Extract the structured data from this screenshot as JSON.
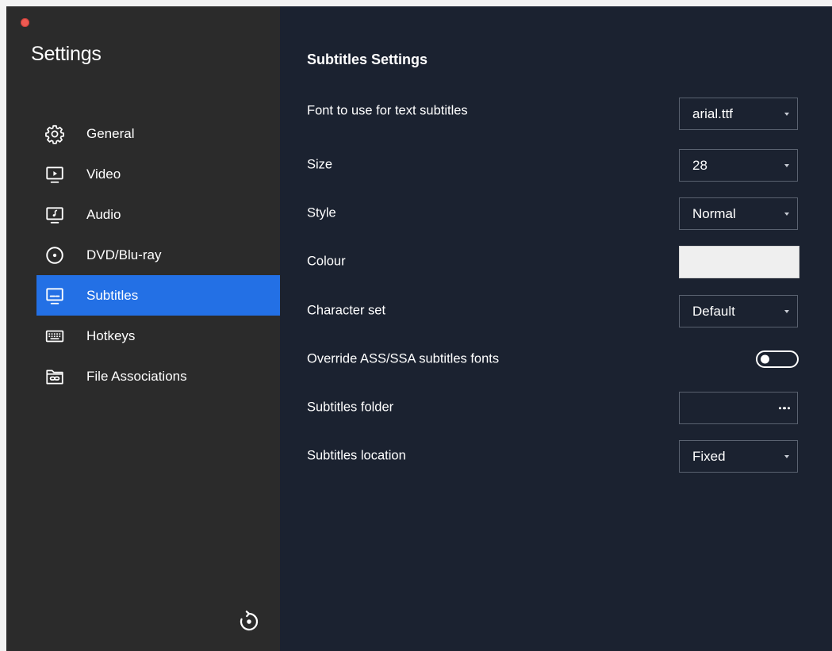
{
  "sidebar": {
    "title": "Settings",
    "items": [
      {
        "label": "General",
        "icon": "gear-icon",
        "active": false
      },
      {
        "label": "Video",
        "icon": "video-monitor-icon",
        "active": false
      },
      {
        "label": "Audio",
        "icon": "audio-monitor-icon",
        "active": false
      },
      {
        "label": "DVD/Blu-ray",
        "icon": "disc-icon",
        "active": false
      },
      {
        "label": "Subtitles",
        "icon": "subtitles-icon",
        "active": true
      },
      {
        "label": "Hotkeys",
        "icon": "keyboard-icon",
        "active": false
      },
      {
        "label": "File Associations",
        "icon": "folder-link-icon",
        "active": false
      }
    ],
    "reset_icon": "reset-icon"
  },
  "main": {
    "title": "Subtitles Settings",
    "font": {
      "label": "Font to use for text subtitles",
      "value": "arial.ttf"
    },
    "size": {
      "label": "Size",
      "value": "28"
    },
    "style": {
      "label": "Style",
      "value": "Normal"
    },
    "colour": {
      "label": "Colour",
      "value": "#efefef"
    },
    "charset": {
      "label": "Character set",
      "value": "Default"
    },
    "override": {
      "label": "Override ASS/SSA subtitles fonts",
      "enabled": false
    },
    "folder": {
      "label": "Subtitles folder",
      "value": ""
    },
    "location": {
      "label": "Subtitles location",
      "value": "Fixed"
    }
  },
  "colors": {
    "sidebar_bg": "#2b2b2b",
    "main_bg": "#1b2230",
    "accent": "#2370e5",
    "close_button": "#ee5a52"
  }
}
